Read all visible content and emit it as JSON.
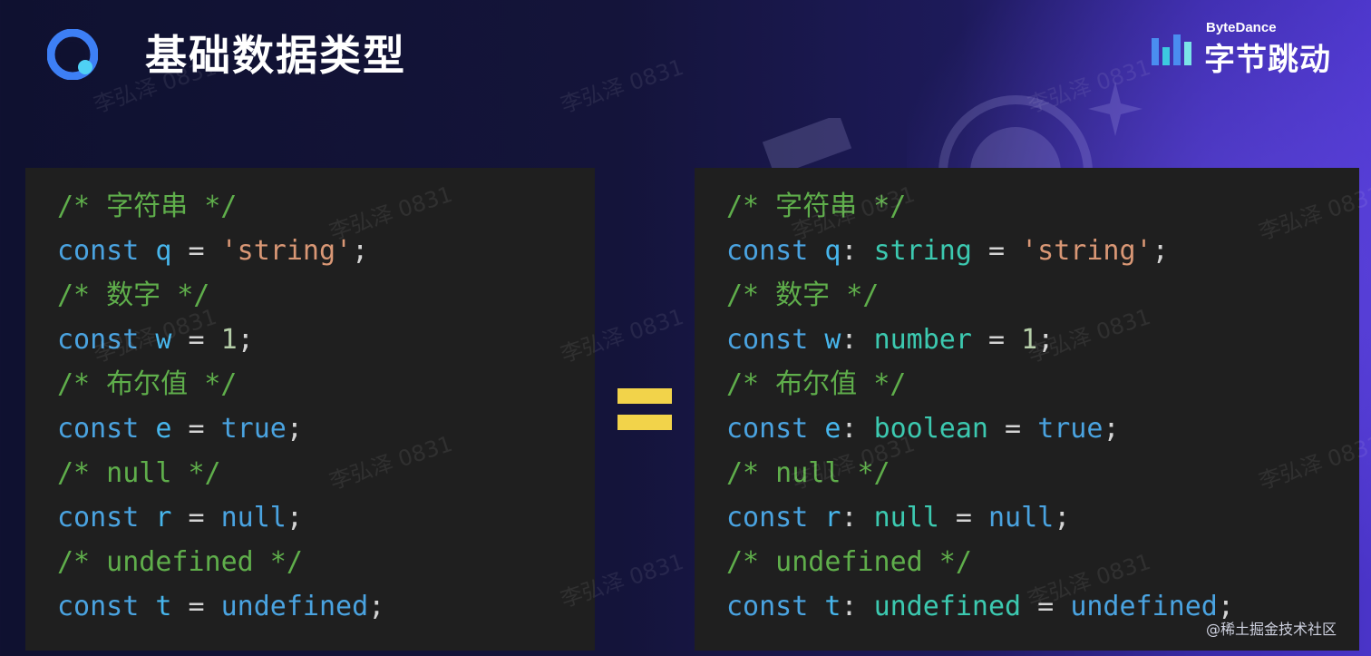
{
  "header": {
    "title": "基础数据类型",
    "brand_en": "ByteDance",
    "brand_cn": "字节跳动"
  },
  "watermark": "李弘泽 0831",
  "left_code": [
    [
      {
        "cls": "c",
        "t": "/* 字符串 */"
      }
    ],
    [
      {
        "cls": "k",
        "t": "const"
      },
      {
        "cls": "o",
        "t": " "
      },
      {
        "cls": "v",
        "t": "q"
      },
      {
        "cls": "o",
        "t": " = "
      },
      {
        "cls": "s",
        "t": "'string'"
      },
      {
        "cls": "p",
        "t": ";"
      }
    ],
    [
      {
        "cls": "c",
        "t": "/* 数字 */"
      }
    ],
    [
      {
        "cls": "k",
        "t": "const"
      },
      {
        "cls": "o",
        "t": " "
      },
      {
        "cls": "v",
        "t": "w"
      },
      {
        "cls": "o",
        "t": " = "
      },
      {
        "cls": "n",
        "t": "1"
      },
      {
        "cls": "p",
        "t": ";"
      }
    ],
    [
      {
        "cls": "c",
        "t": "/* 布尔值 */"
      }
    ],
    [
      {
        "cls": "k",
        "t": "const"
      },
      {
        "cls": "o",
        "t": " "
      },
      {
        "cls": "v",
        "t": "e"
      },
      {
        "cls": "o",
        "t": " = "
      },
      {
        "cls": "kw",
        "t": "true"
      },
      {
        "cls": "p",
        "t": ";"
      }
    ],
    [
      {
        "cls": "c",
        "t": "/* null */"
      }
    ],
    [
      {
        "cls": "k",
        "t": "const"
      },
      {
        "cls": "o",
        "t": " "
      },
      {
        "cls": "v",
        "t": "r"
      },
      {
        "cls": "o",
        "t": " = "
      },
      {
        "cls": "kw",
        "t": "null"
      },
      {
        "cls": "p",
        "t": ";"
      }
    ],
    [
      {
        "cls": "c",
        "t": "/* undefined */"
      }
    ],
    [
      {
        "cls": "k",
        "t": "const"
      },
      {
        "cls": "o",
        "t": " "
      },
      {
        "cls": "v",
        "t": "t"
      },
      {
        "cls": "o",
        "t": " = "
      },
      {
        "cls": "kw",
        "t": "undefined"
      },
      {
        "cls": "p",
        "t": ";"
      }
    ]
  ],
  "right_code": [
    [
      {
        "cls": "c",
        "t": "/* 字符串 */"
      }
    ],
    [
      {
        "cls": "k",
        "t": "const"
      },
      {
        "cls": "o",
        "t": " "
      },
      {
        "cls": "v",
        "t": "q"
      },
      {
        "cls": "p",
        "t": ": "
      },
      {
        "cls": "t",
        "t": "string"
      },
      {
        "cls": "o",
        "t": " = "
      },
      {
        "cls": "s",
        "t": "'string'"
      },
      {
        "cls": "p",
        "t": ";"
      }
    ],
    [
      {
        "cls": "c",
        "t": "/* 数字 */"
      }
    ],
    [
      {
        "cls": "k",
        "t": "const"
      },
      {
        "cls": "o",
        "t": " "
      },
      {
        "cls": "v",
        "t": "w"
      },
      {
        "cls": "p",
        "t": ": "
      },
      {
        "cls": "t",
        "t": "number"
      },
      {
        "cls": "o",
        "t": " = "
      },
      {
        "cls": "n",
        "t": "1"
      },
      {
        "cls": "p",
        "t": ";"
      }
    ],
    [
      {
        "cls": "c",
        "t": "/* 布尔值 */"
      }
    ],
    [
      {
        "cls": "k",
        "t": "const"
      },
      {
        "cls": "o",
        "t": " "
      },
      {
        "cls": "v",
        "t": "e"
      },
      {
        "cls": "p",
        "t": ": "
      },
      {
        "cls": "t",
        "t": "boolean"
      },
      {
        "cls": "o",
        "t": " = "
      },
      {
        "cls": "kw",
        "t": "true"
      },
      {
        "cls": "p",
        "t": ";"
      }
    ],
    [
      {
        "cls": "c",
        "t": "/* null */"
      }
    ],
    [
      {
        "cls": "k",
        "t": "const"
      },
      {
        "cls": "o",
        "t": " "
      },
      {
        "cls": "v",
        "t": "r"
      },
      {
        "cls": "p",
        "t": ": "
      },
      {
        "cls": "t",
        "t": "null"
      },
      {
        "cls": "o",
        "t": " = "
      },
      {
        "cls": "kw",
        "t": "null"
      },
      {
        "cls": "p",
        "t": ";"
      }
    ],
    [
      {
        "cls": "c",
        "t": "/* undefined */"
      }
    ],
    [
      {
        "cls": "k",
        "t": "const"
      },
      {
        "cls": "o",
        "t": " "
      },
      {
        "cls": "v",
        "t": "t"
      },
      {
        "cls": "p",
        "t": ": "
      },
      {
        "cls": "t",
        "t": "undefined"
      },
      {
        "cls": "o",
        "t": " = "
      },
      {
        "cls": "kw",
        "t": "undefined"
      },
      {
        "cls": "p",
        "t": ";"
      }
    ]
  ],
  "footer": "@稀土掘金技术社区",
  "colors": {
    "comment": "#5fae4b",
    "keyword": "#4aa3e0",
    "string": "#d99775",
    "number": "#b5cea8",
    "type": "#3cc9b0",
    "equals_sign": "#f2d34a"
  }
}
